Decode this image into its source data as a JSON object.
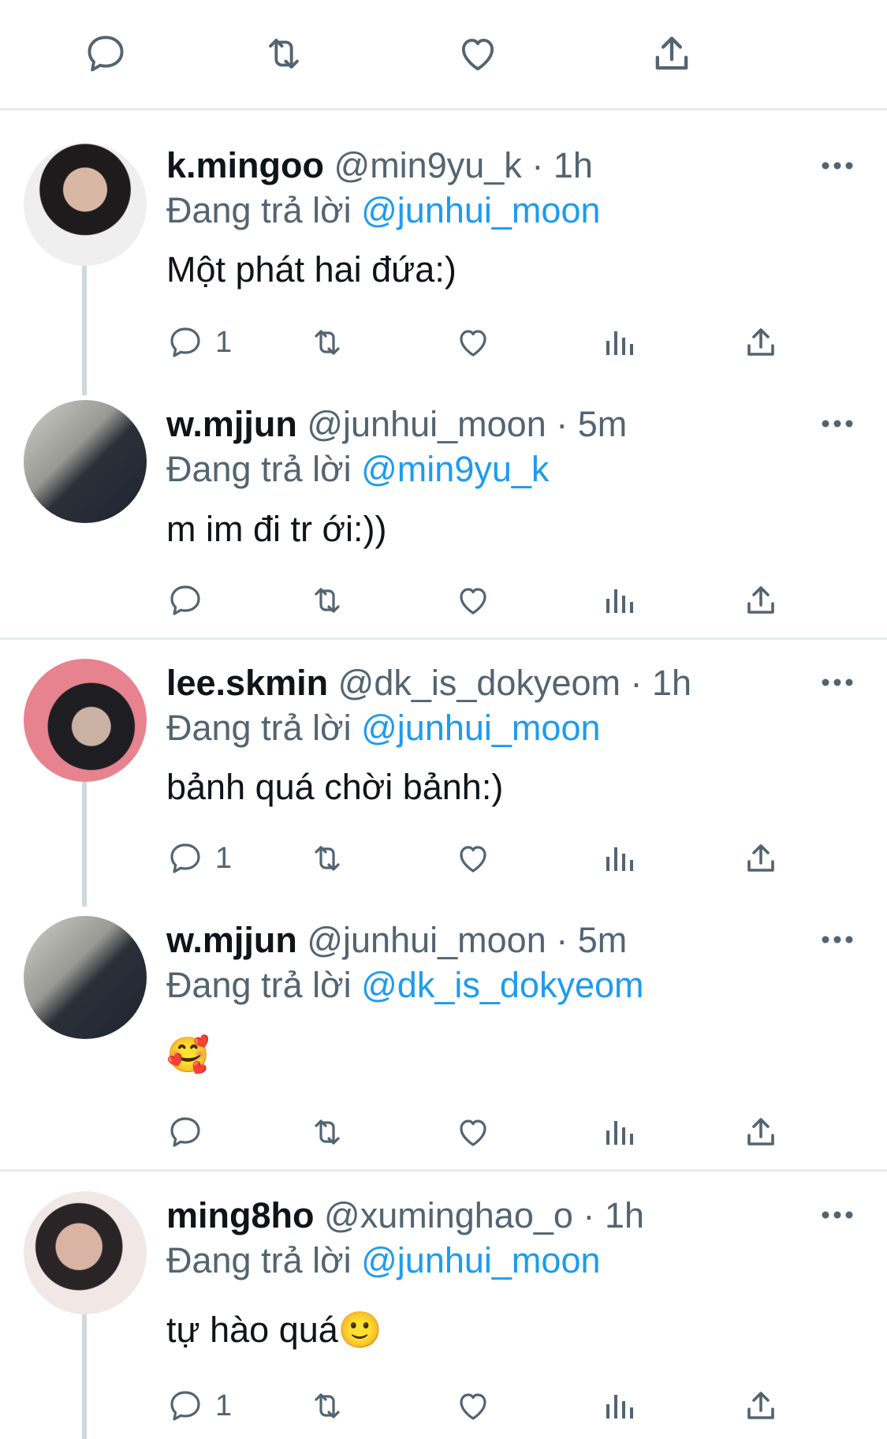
{
  "colors": {
    "accent": "#1d9bf0",
    "text": "#0f1419",
    "muted": "#536471",
    "border": "#e6ecf0"
  },
  "reply_label": "Đang trả lời",
  "tweets": [
    {
      "name": "k.mingoo",
      "handle": "@min9yu_k",
      "sep": "·",
      "time": "1h",
      "reply_to": "@junhui_moon",
      "text": "Một phát hai đứa:)",
      "reply_count": "1",
      "avatar": "avatar-mingoo"
    },
    {
      "name": "w.mjjun",
      "handle": "@junhui_moon",
      "sep": "·",
      "time": "5m",
      "reply_to": "@min9yu_k",
      "text": "m im đi tr ới:))",
      "reply_count": "",
      "avatar": "avatar-mjjun"
    },
    {
      "name": "lee.skmin",
      "handle": "@dk_is_dokyeom",
      "sep": "·",
      "time": "1h",
      "reply_to": "@junhui_moon",
      "text": "bảnh quá chời bảnh:)",
      "reply_count": "1",
      "avatar": "avatar-skmin"
    },
    {
      "name": "w.mjjun",
      "handle": "@junhui_moon",
      "sep": "·",
      "time": "5m",
      "reply_to": "@dk_is_dokyeom",
      "text": "🥰",
      "reply_count": "",
      "avatar": "avatar-mjjun"
    },
    {
      "name": "ming8ho",
      "handle": "@xuminghao_o",
      "sep": "·",
      "time": "1h",
      "reply_to": "@junhui_moon",
      "text": "tự hào quá🙂",
      "reply_count": "1",
      "avatar": "avatar-ming8ho"
    }
  ]
}
